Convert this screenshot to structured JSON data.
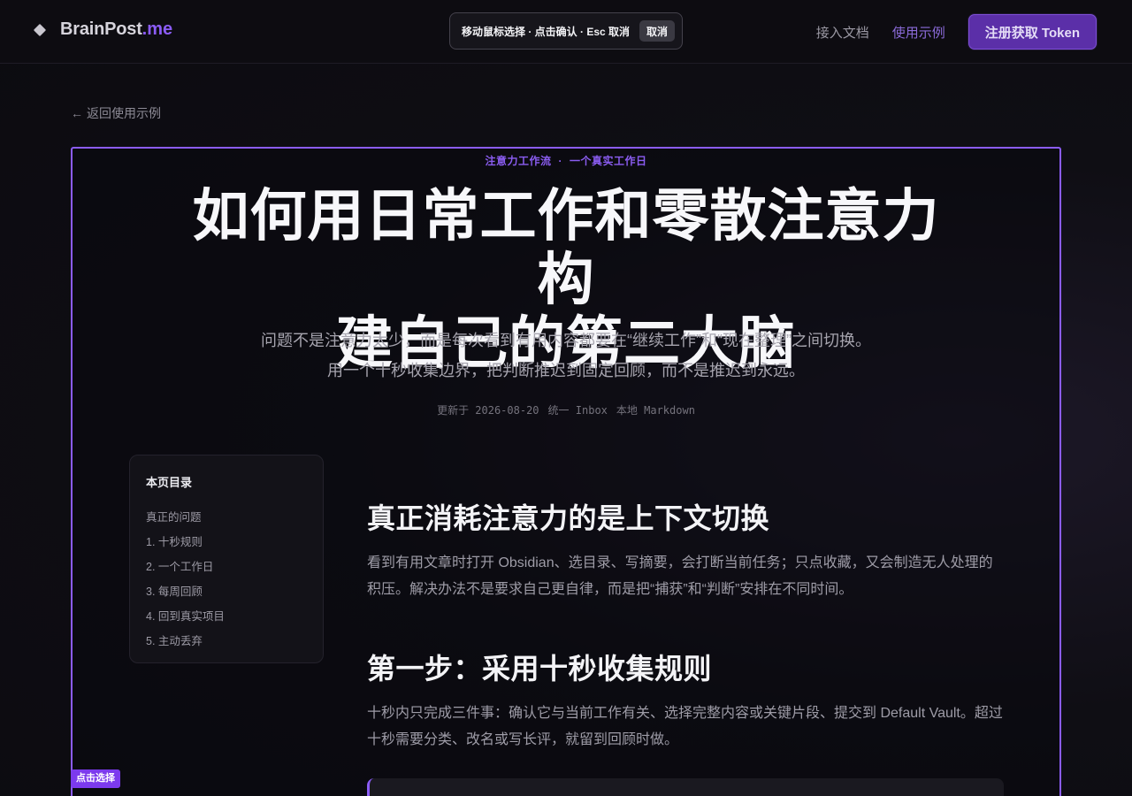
{
  "nav": {
    "brand_name": "BrainPost",
    "brand_tld": ".me",
    "links": [
      {
        "label": "接入文档",
        "active": false
      },
      {
        "label": "使用示例",
        "active": true
      }
    ],
    "cta_label": "注册获取 Token"
  },
  "picker": {
    "message": "移动鼠标选择 · 点击确认 · Esc 取消",
    "cancel_label": "取消",
    "select_badge": "点击选择"
  },
  "back_link": "返回使用示例",
  "article": {
    "kicker_left": "注意力工作流",
    "kicker_sep": "·",
    "kicker_right": "一个真实工作日",
    "title_line1": "如何用日常工作和零散注意力构",
    "title_line2": "建自己的第二大脑",
    "subtitle_line1": "问题不是注意力太少，而是每次看到有用内容都要在“继续工作”和“现在整理”之间切换。",
    "subtitle_line2": "用一个十秒收集边界，把判断推迟到固定回顾，而不是推迟到永远。",
    "meta": [
      "更新于 2026-08-20",
      "统一 Inbox",
      "本地 Markdown"
    ]
  },
  "toc": {
    "title": "本页目录",
    "items": [
      "真正的问题",
      "1. 十秒规则",
      "2. 一个工作日",
      "3. 每周回顾",
      "4. 回到真实项目",
      "5. 主动丢弃"
    ]
  },
  "sections": [
    {
      "heading": "真正消耗注意力的是上下文切换",
      "body": "看到有用文章时打开 Obsidian、选目录、写摘要，会打断当前任务；只点收藏，又会制造无人处理的积压。解决办法不是要求自己更自律，而是把“捕获”和“判断”安排在不同时间。"
    },
    {
      "heading": "第一步：采用十秒收集规则",
      "body": "十秒内只完成三件事：确认它与当前工作有关、选择完整内容或关键片段、提交到 Default Vault。超过十秒需要分类、改名或写长评，就留到回顾时做。"
    }
  ],
  "colors": {
    "accent": "#8b5cf6",
    "cta_bg": "#5b2fa8",
    "background": "#0e0d13"
  }
}
